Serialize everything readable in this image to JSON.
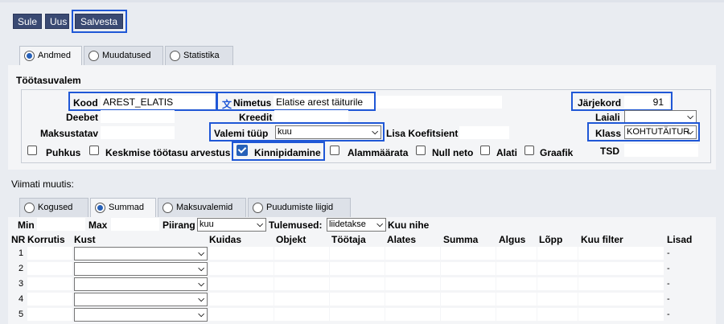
{
  "toolbar": {
    "close": "Sule",
    "new": "Uus",
    "save": "Salvesta"
  },
  "tabs": [
    {
      "label": "Andmed",
      "selected": true
    },
    {
      "label": "Muudatused",
      "selected": false
    },
    {
      "label": "Statistika",
      "selected": false
    }
  ],
  "section_title": "Töötasuvalem",
  "form": {
    "kood_label": "Kood",
    "kood_value": "AREST_ELATIS",
    "translate_icon": "文",
    "nimetus_label": "Nimetus",
    "nimetus_value": "Elatise arest täiturile",
    "jarjekord_label": "Järjekord",
    "jarjekord_value": "91",
    "deebet_label": "Deebet",
    "deebet_value": "",
    "kreedit_label": "Kreedit",
    "kreedit_value": "",
    "laiali_label": "Laiali",
    "laiali_value": "",
    "maksustatav_label": "Maksustatav",
    "maksustatav_value": "",
    "valemi_tuup_label": "Valemi tüüp",
    "valemi_tuup_value": "kuu",
    "lisa_koef_label": "Lisa Koefitsient",
    "lisa_koef_value": "",
    "klass_label": "Klass",
    "klass_value": "KOHTUTÄITUR",
    "tsd_label": "TSD",
    "tsd_value": "",
    "checkboxes": [
      {
        "label": "Puhkus",
        "checked": false
      },
      {
        "label": "Keskmise töötasu arvestus",
        "checked": false
      },
      {
        "label": "Kinnipidamine",
        "checked": true
      },
      {
        "label": "Alammäärata",
        "checked": false
      },
      {
        "label": "Null neto",
        "checked": false
      },
      {
        "label": "Alati",
        "checked": false
      },
      {
        "label": "Graafik",
        "checked": false
      }
    ]
  },
  "viimati": "Viimati muutis:",
  "subtabs": [
    {
      "label": "Kogused",
      "selected": false
    },
    {
      "label": "Summad",
      "selected": true
    },
    {
      "label": "Maksuvalemid",
      "selected": false
    },
    {
      "label": "Puudumiste liigid",
      "selected": false
    }
  ],
  "filters": {
    "min_label": "Min",
    "max_label": "Max",
    "piirang_label": "Piirang",
    "piirang_value": "kuu",
    "tulemused_label": "Tulemused:",
    "tulemused_value": "liidetakse",
    "kuu_nihe_label": "Kuu nihe"
  },
  "grid": {
    "headers": [
      "NR",
      "Korrutis",
      "Kust",
      "Kuidas",
      "Objekt",
      "Töötaja",
      "Alates",
      "Summa",
      "Algus",
      "Lõpp",
      "Kuu filter",
      "Lisad"
    ],
    "rows": [
      {
        "nr": "1",
        "lisad": "-"
      },
      {
        "nr": "2",
        "lisad": "-"
      },
      {
        "nr": "3",
        "lisad": "-"
      },
      {
        "nr": "4",
        "lisad": "-"
      },
      {
        "nr": "5",
        "lisad": "-"
      }
    ]
  },
  "colors": {
    "button": "#3a4a73",
    "highlight": "#1f57d6",
    "radio_on": "#2660b8"
  }
}
